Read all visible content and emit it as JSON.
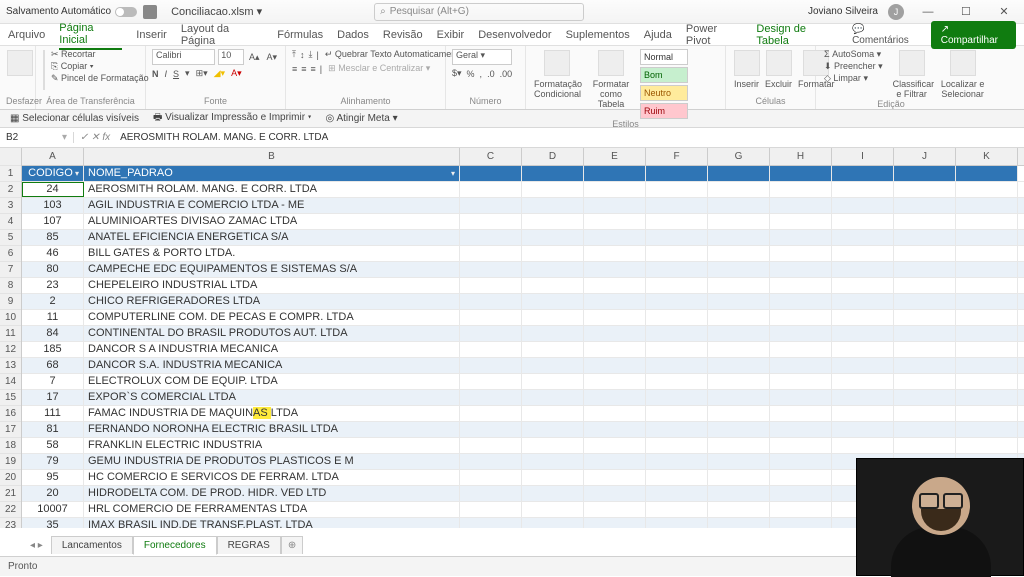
{
  "title": {
    "autosave": "Salvamento Automático",
    "filename": "Conciliacao.xlsm",
    "search_placeholder": "Pesquisar (Alt+G)",
    "user": "Joviano Silveira",
    "user_initial": "J"
  },
  "tabs": {
    "items": [
      "Arquivo",
      "Página Inicial",
      "Inserir",
      "Layout da Página",
      "Fórmulas",
      "Dados",
      "Revisão",
      "Exibir",
      "Desenvolvedor",
      "Suplementos",
      "Ajuda",
      "Power Pivot",
      "Design de Tabela"
    ],
    "active": 1,
    "comments": "Comentários",
    "share": "Compartilhar"
  },
  "ribbon": {
    "undo": "Desfazer",
    "clipboard": {
      "label": "Área de Transferência",
      "paste": "Colar",
      "cut": "Recortar",
      "copy": "Copiar",
      "painter": "Pincel de Formatação"
    },
    "font": {
      "label": "Fonte",
      "name": "Calibri",
      "size": "10",
      "bold": "N",
      "italic": "I",
      "underline": "S"
    },
    "align": {
      "label": "Alinhamento",
      "wrap": "Quebrar Texto Automaticamente",
      "merge": "Mesclar e Centralizar"
    },
    "number": {
      "label": "Número",
      "format": "Geral"
    },
    "styles": {
      "label": "Estilos",
      "conditional": "Formatação Condicional",
      "astable": "Formatar como Tabela",
      "chips": [
        {
          "t": "Normal",
          "bg": "#fff",
          "c": "#333"
        },
        {
          "t": "Bom",
          "bg": "#c6efce",
          "c": "#006100"
        },
        {
          "t": "Neutro",
          "bg": "#ffeb9c",
          "c": "#9c5700"
        },
        {
          "t": "Ruim",
          "bg": "#ffc7ce",
          "c": "#9c0006"
        }
      ]
    },
    "cells": {
      "label": "Células",
      "insert": "Inserir",
      "delete": "Excluir",
      "format": "Formatar"
    },
    "editing": {
      "label": "Edição",
      "autosum": "AutoSoma",
      "fill": "Preencher",
      "clear": "Limpar",
      "sort": "Classificar e Filtrar",
      "find": "Localizar e Selecionar"
    }
  },
  "subbar": {
    "a": "Selecionar células visíveis",
    "b": "Visualizar Impressão e Imprimir",
    "c": "Atingir Meta"
  },
  "formula": {
    "cell": "B2",
    "value": "AEROSMITH ROLAM. MANG. E CORR. LTDA"
  },
  "cols": [
    "A",
    "B",
    "C",
    "D",
    "E",
    "F",
    "G",
    "H",
    "I",
    "J",
    "K"
  ],
  "headers": {
    "a": "CODIGO",
    "b": "NOME_PADRAO"
  },
  "rows": [
    {
      "n": 2,
      "a": "24",
      "b": "AEROSMITH ROLAM. MANG. E CORR. LTDA"
    },
    {
      "n": 3,
      "a": "103",
      "b": "AGIL INDUSTRIA E COMERCIO LTDA - ME"
    },
    {
      "n": 4,
      "a": "107",
      "b": "ALUMINIOARTES DIVISAO ZAMAC LTDA"
    },
    {
      "n": 5,
      "a": "85",
      "b": "ANATEL EFICIENCIA ENERGETICA S/A"
    },
    {
      "n": 6,
      "a": "46",
      "b": "BILL GATES & PORTO LTDA."
    },
    {
      "n": 7,
      "a": "80",
      "b": "CAMPECHE EDC EQUIPAMENTOS E SISTEMAS S/A"
    },
    {
      "n": 8,
      "a": "23",
      "b": "CHEPELEIRO INDUSTRIAL LTDA"
    },
    {
      "n": 9,
      "a": "2",
      "b": "CHICO REFRIGERADORES LTDA"
    },
    {
      "n": 10,
      "a": "11",
      "b": "COMPUTERLINE COM. DE PECAS E COMPR. LTDA"
    },
    {
      "n": 11,
      "a": "84",
      "b": "CONTINENTAL DO BRASIL PRODUTOS AUT. LTDA"
    },
    {
      "n": 12,
      "a": "185",
      "b": "DANCOR S A INDUSTRIA MECANICA"
    },
    {
      "n": 13,
      "a": "68",
      "b": "DANCOR S.A. INDUSTRIA MECANICA"
    },
    {
      "n": 14,
      "a": "7",
      "b": "ELECTROLUX COM DE EQUIP. LTDA"
    },
    {
      "n": 15,
      "a": "17",
      "b": "EXPOR`S COMERCIAL LTDA"
    },
    {
      "n": 16,
      "a": "111",
      "b": "FAMAC INDUSTRIA DE MAQUINAS LTDA",
      "hl": [
        25,
        28
      ]
    },
    {
      "n": 17,
      "a": "81",
      "b": "FERNANDO NORONHA ELECTRIC BRASIL LTDA"
    },
    {
      "n": 18,
      "a": "58",
      "b": "FRANKLIN ELECTRIC INDUSTRIA"
    },
    {
      "n": 19,
      "a": "79",
      "b": "GEMU INDUSTRIA DE PRODUTOS PLASTICOS E M"
    },
    {
      "n": 20,
      "a": "95",
      "b": "HC COMERCIO E SERVICOS DE FERRAM. LTDA"
    },
    {
      "n": 21,
      "a": "20",
      "b": "HIDRODELTA COM. DE PROD. HIDR. VED LTD"
    },
    {
      "n": 22,
      "a": "10007",
      "b": "HRL COMERCIO DE FERRAMENTAS LTDA"
    },
    {
      "n": 23,
      "a": "35",
      "b": "IMAX BRASIL IND.DE TRANSF.PLAST. LTDA"
    }
  ],
  "sheets": {
    "items": [
      "Lancamentos",
      "Fornecedores",
      "REGRAS"
    ],
    "active": 1
  },
  "status": "Pronto"
}
